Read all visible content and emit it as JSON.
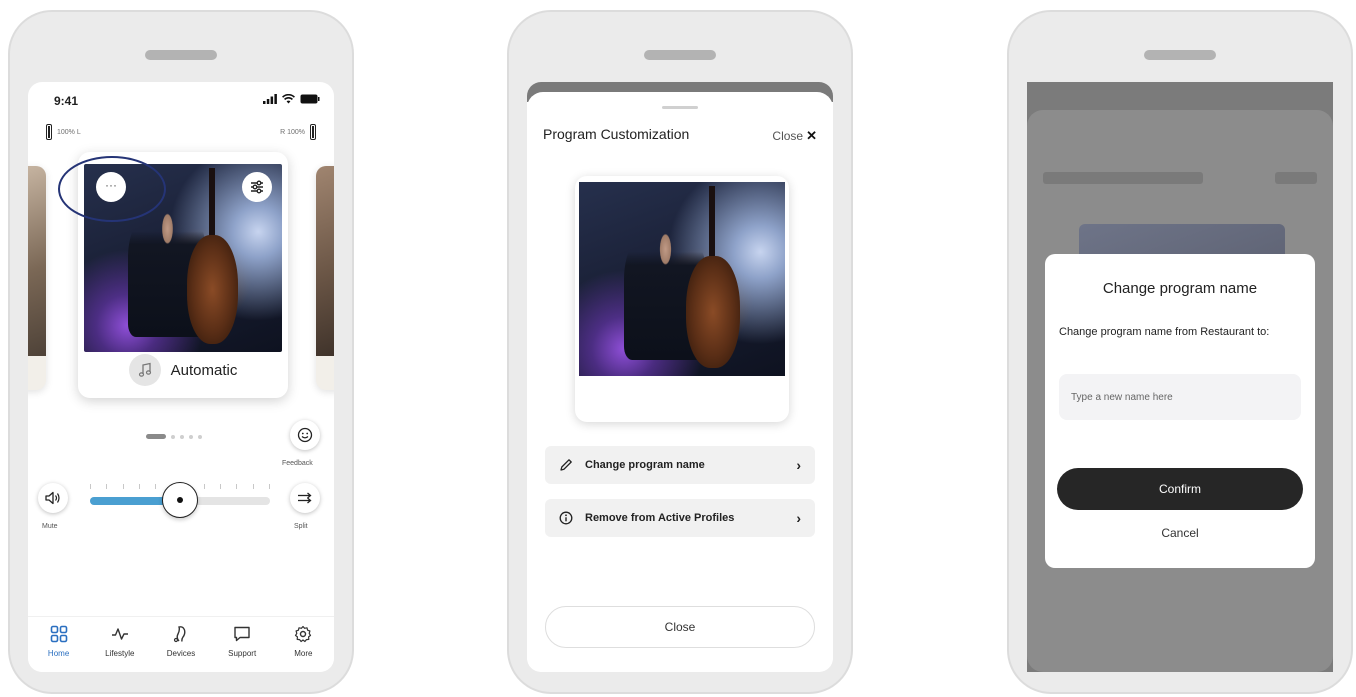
{
  "phone1": {
    "status": {
      "time": "9:41"
    },
    "battery": {
      "left": "100% L",
      "right": "R 100%"
    },
    "card": {
      "menu_label": "···",
      "program_name": "Automatic"
    },
    "feedback_label": "Feedback",
    "mute_label": "Mute",
    "split_label": "Split",
    "volume_level": 0.5,
    "nav": [
      {
        "label": "Home",
        "icon": "grid-icon"
      },
      {
        "label": "Lifestyle",
        "icon": "pulse-icon"
      },
      {
        "label": "Devices",
        "icon": "hearing-aid-icon"
      },
      {
        "label": "Support",
        "icon": "chat-bubble-icon"
      },
      {
        "label": "More",
        "icon": "gear-icon"
      }
    ]
  },
  "phone2": {
    "title": "Program Customization",
    "close_label": "Close",
    "items": [
      {
        "label": "Change program name",
        "icon": "pencil-icon"
      },
      {
        "label": "Remove from Active Profiles",
        "icon": "info-icon"
      }
    ],
    "close_button": "Close"
  },
  "phone3": {
    "title": "Change program name",
    "body": "Change program name from Restaurant to:",
    "input": {
      "placeholder": "Type a new name here",
      "value": ""
    },
    "confirm": "Confirm",
    "cancel": "Cancel"
  },
  "colors": {
    "accent": "#4a9fd1",
    "active_nav": "#2a6fc0",
    "highlight_ring": "#253476",
    "confirm_bg": "#262626"
  }
}
